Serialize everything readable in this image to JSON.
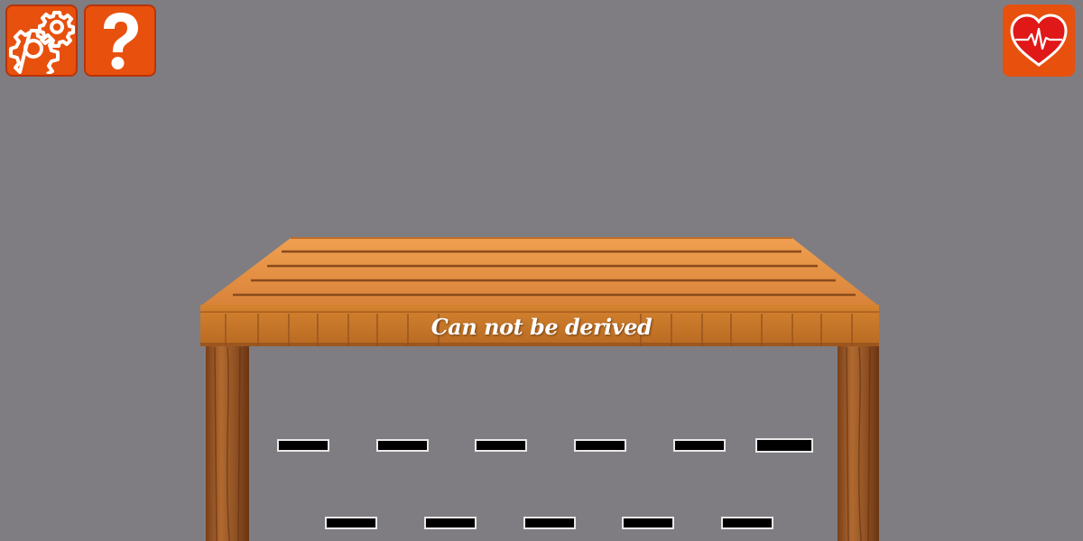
{
  "toolbar": {
    "settings_icon": "gears-icon",
    "help_icon": "question-mark-icon",
    "health_icon": "heart-pulse-icon"
  },
  "colors": {
    "background": "#7f7d82",
    "button": "#e8500e",
    "wood": "#d9893a",
    "wood_dark": "#8a4a1c"
  },
  "table": {
    "label": "Can not be derived"
  },
  "answer_slots": {
    "row1_count": 6,
    "row2_count": 5
  }
}
